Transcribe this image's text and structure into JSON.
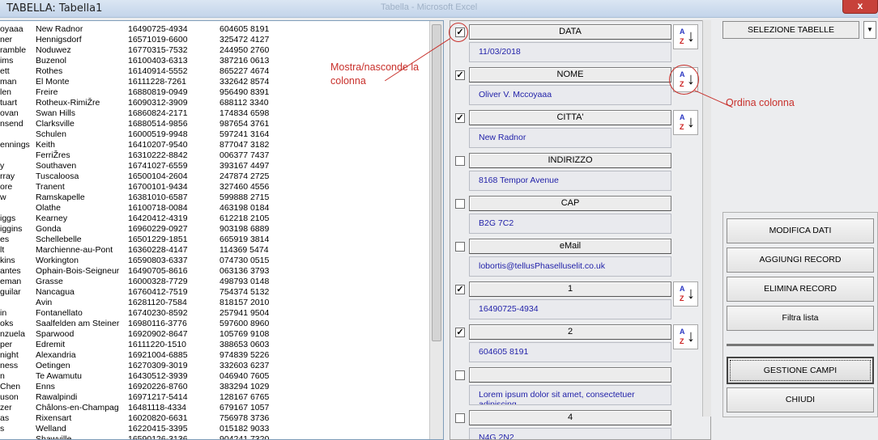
{
  "window": {
    "title": "TABELLA: Tabella1",
    "ghost_title": "Tabella - Microsoft Excel",
    "close_glyph": "x"
  },
  "list": {
    "rows": [
      [
        "oyaaa",
        "New Radnor",
        "16490725-4934",
        "604605 8191"
      ],
      [
        "ner",
        "Hennigsdorf",
        "16571019-6600",
        "325472 4127"
      ],
      [
        "ramble",
        "Noduwez",
        "16770315-7532",
        "244950 2760"
      ],
      [
        "ims",
        "Buzenol",
        "16100403-6313",
        "387216 0613"
      ],
      [
        "ett",
        "Rothes",
        "16140914-5552",
        "865227 4674"
      ],
      [
        "man",
        "El Monte",
        "16111228-7261",
        "332642 8574"
      ],
      [
        "len",
        "Freire",
        "16880819-0949",
        "956490 8391"
      ],
      [
        "tuart",
        "Rotheux-RimiŽre",
        "16090312-3909",
        "688112 3340"
      ],
      [
        "ovan",
        "Swan Hills",
        "16860824-2171",
        "174834 6598"
      ],
      [
        "nsend",
        "Clarksville",
        "16880514-9856",
        "987654 3761"
      ],
      [
        "",
        "Schulen",
        "16000519-9948",
        "597241 3164"
      ],
      [
        "ennings",
        "Keith",
        "16410207-9540",
        "877047 3182"
      ],
      [
        "",
        "FerriŽres",
        "16310222-8842",
        "006377 7437"
      ],
      [
        "y",
        "Southaven",
        "16741027-6559",
        "393167 4497"
      ],
      [
        "rray",
        "Tuscaloosa",
        "16500104-2604",
        "247874 2725"
      ],
      [
        "ore",
        "Tranent",
        "16700101-9434",
        "327460 4556"
      ],
      [
        "w",
        "Ramskapelle",
        "16381010-6587",
        "599888 2715"
      ],
      [
        "",
        "Olathe",
        "16100718-0084",
        "463198 0184"
      ],
      [
        "iggs",
        "Kearney",
        "16420412-4319",
        "612218 2105"
      ],
      [
        "iggins",
        "Gonda",
        "16960229-0927",
        "903198 6889"
      ],
      [
        "es",
        "Schellebelle",
        "16501229-1851",
        "665919 3814"
      ],
      [
        "lt",
        "Marchienne-au-Pont",
        "16360228-4147",
        "114369 5474"
      ],
      [
        "kins",
        "Workington",
        "16590803-6337",
        "074730 0515"
      ],
      [
        "antes",
        "Ophain-Bois-Seigneur",
        "16490705-8616",
        "063136 3793"
      ],
      [
        "eman",
        "Grasse",
        "16000328-7729",
        "498793 0148"
      ],
      [
        "guilar",
        "Nancagua",
        "16760412-7519",
        "754374 5132"
      ],
      [
        "",
        "Avin",
        "16281120-7584",
        "818157 2010"
      ],
      [
        "in",
        "Fontanellato",
        "16740230-8592",
        "257941 9504"
      ],
      [
        "oks",
        "Saalfelden am Steiner",
        "16980116-3776",
        "597600 8960"
      ],
      [
        "nzuela",
        "Sparwood",
        "16920902-8647",
        "105769 9108"
      ],
      [
        "per",
        "Edremit",
        "16111220-1510",
        "388653 0603"
      ],
      [
        "night",
        "Alexandria",
        "16921004-6885",
        "974839 5226"
      ],
      [
        "ness",
        "Oetingen",
        "16270309-3019",
        "332603 6237"
      ],
      [
        "n",
        "Te Awamutu",
        "16430512-3939",
        "046940 7605"
      ],
      [
        "Chen",
        "Enns",
        "16920226-8760",
        "383294 1029"
      ],
      [
        "uson",
        "Rawalpindi",
        "16971217-5414",
        "128167 6765"
      ],
      [
        "zer",
        "Châlons-en-Champag",
        "16481118-4334",
        "679167 1057"
      ],
      [
        "as",
        "Rixensart",
        "16020820-6631",
        "756978 3736"
      ],
      [
        "s",
        "Welland",
        "16220415-3395",
        "015182 9033"
      ],
      [
        "",
        "Shawville",
        "16590126-3136",
        "904241 7320"
      ]
    ]
  },
  "fields": [
    {
      "checked": true,
      "header": "DATA",
      "value": "11/03/2018",
      "sortable": true
    },
    {
      "checked": true,
      "header": "NOME",
      "value": "Oliver V. Mccoyaaa",
      "sortable": true
    },
    {
      "checked": true,
      "header": "CITTA'",
      "value": "New Radnor",
      "sortable": true
    },
    {
      "checked": false,
      "header": "INDIRIZZO",
      "value": "8168 Tempor Avenue",
      "sortable": false
    },
    {
      "checked": false,
      "header": "CAP",
      "value": "B2G 7C2",
      "sortable": false
    },
    {
      "checked": false,
      "header": "eMail",
      "value": "lobortis@tellusPhaselluselit.co.uk",
      "sortable": false
    },
    {
      "checked": true,
      "header": "1",
      "value": "16490725-4934",
      "sortable": true
    },
    {
      "checked": true,
      "header": "2",
      "value": "604605 8191",
      "sortable": true
    },
    {
      "checked": false,
      "header": "",
      "value": "Lorem ipsum dolor sit amet, consectetuer adipiscing",
      "sortable": false
    },
    {
      "checked": false,
      "header": "4",
      "value": "N4G 2N2",
      "sortable": false
    }
  ],
  "sort_icon": {
    "a": "A",
    "z": "Z",
    "arrow": "↓"
  },
  "right": {
    "select_label": "SELEZIONE TABELLE",
    "dropdown_glyph": "▼",
    "buttons": {
      "modify": "MODIFICA DATI",
      "add": "AGGIUNGI RECORD",
      "delete": "ELIMINA RECORD",
      "filter": "Filtra lista",
      "manage": "GESTIONE CAMPI",
      "close": "CHIUDI"
    }
  },
  "annotations": {
    "show_hide": "Mostra/nasconde la colonna",
    "sort": "Ordina colonna",
    "color": "#c8302b"
  }
}
